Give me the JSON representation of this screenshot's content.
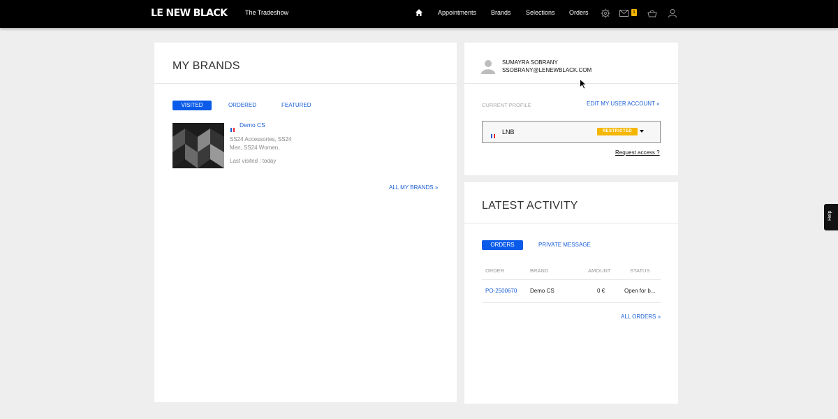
{
  "header": {
    "logo": "LE NEW BLACK",
    "subtitle": "The Tradeshow",
    "nav": [
      "Appointments",
      "Brands",
      "Selections",
      "Orders"
    ],
    "message_count": "1"
  },
  "my_brands": {
    "title": "MY BRANDS",
    "tabs": [
      "VISITED",
      "ORDERED",
      "FEATURED"
    ],
    "brand": {
      "name": "Demo CS",
      "collections_line1": "SS24 Accessories, SS24",
      "collections_line2": "Men, SS24 Women,",
      "last_visited": "Last visited : today"
    },
    "all_link": "ALL MY BRANDS »"
  },
  "user": {
    "name": "SUMAYRA SOBRANY",
    "email": "SSOBRANY@LENEWBLACK.COM",
    "current_profile_label": "CURRENT PROFILE",
    "edit_link": "EDIT MY USER ACCOUNT »",
    "profile_name": "LNB",
    "profile_status": "RESTRICTED",
    "request_access": "Request access ?"
  },
  "activity": {
    "title": "LATEST ACTIVITY",
    "tabs": [
      "ORDERS",
      "PRIVATE MESSAGE"
    ],
    "columns": [
      "ORDER",
      "BRAND",
      "AMOUNT",
      "STATUS"
    ],
    "rows": [
      {
        "order": "PO-2500670",
        "brand": "Demo CS",
        "amount": "0 €",
        "status": "Open for b..."
      }
    ],
    "all_link": "ALL ORDERS »"
  },
  "help_label": "Help",
  "colors": {
    "accent": "#0a5bea",
    "badge": "#f5b600",
    "topbar": "#000000"
  }
}
